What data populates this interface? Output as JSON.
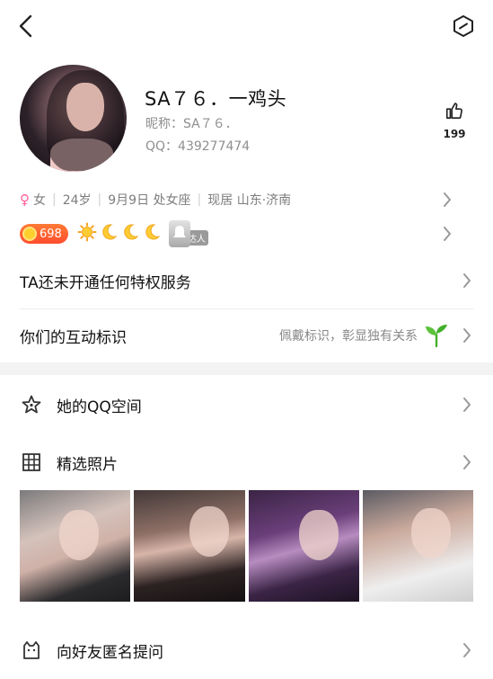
{
  "profile": {
    "name": "SA７６．一鸡头",
    "nickname": "昵称：SA７６．",
    "qq": "QQ：439277474",
    "likes": "199"
  },
  "info": {
    "gender": "女",
    "age": "24岁",
    "birthday": "9月9日 处女座",
    "location": "现居 山东·济南"
  },
  "badges": {
    "level": "698",
    "talent": "达人"
  },
  "menu": {
    "privilege": "TA还未开通任何特权服务",
    "interaction": "你们的互动标识",
    "interaction_hint": "佩戴标识，彰显独有关系"
  },
  "list": {
    "qzone": "她的QQ空间",
    "photos": "精选照片",
    "anon_question": "向好友匿名提问"
  },
  "colors": {
    "female": "#ff5c9a",
    "level_badge": "#ff5a30",
    "sprout": "#43b02a"
  }
}
